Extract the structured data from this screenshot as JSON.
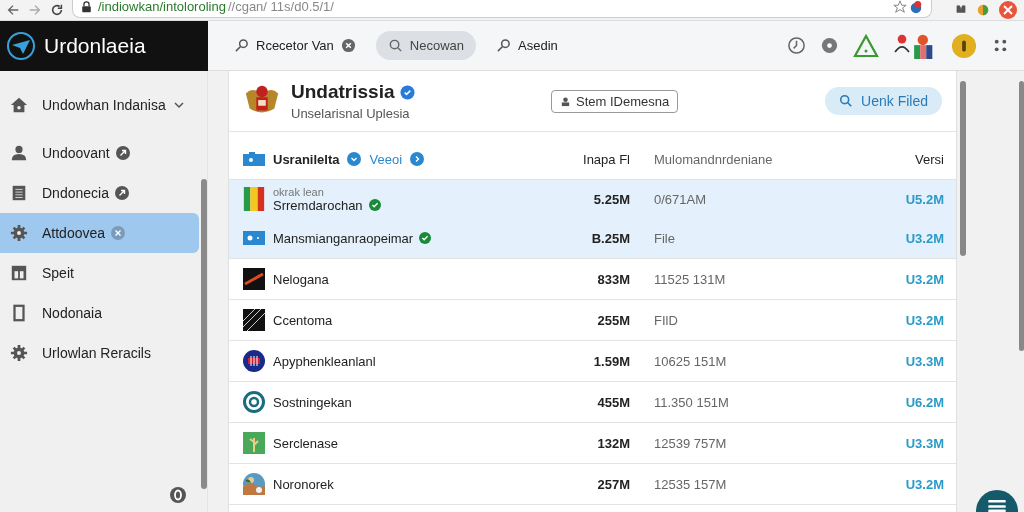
{
  "browser": {
    "url_host": "/indiowkan/intoloroling",
    "url_path": "//cgan/ 11s/d0.5/1/"
  },
  "app": {
    "title": "Urdonlaeia"
  },
  "tabs": [
    {
      "label": "Rcecetor Van",
      "selected": false
    },
    {
      "label": "Necowan",
      "selected": true
    },
    {
      "label": "Asedin",
      "selected": false
    }
  ],
  "sidebar": {
    "items": [
      {
        "label": "Undowhan Indanisa",
        "selected": false
      },
      {
        "label": "Undoovant",
        "selected": false
      },
      {
        "label": "Dndonecia",
        "selected": false
      },
      {
        "label": "Attdoovea",
        "selected": true
      },
      {
        "label": "Speit",
        "selected": false
      },
      {
        "label": "Nodonaia",
        "selected": false
      },
      {
        "label": "Urlowlan Reracils",
        "selected": false
      }
    ]
  },
  "profile": {
    "name": "Undatrissia",
    "verified": true,
    "subtitle": "Unselarisnal Uplesia",
    "tag_button": "Stem IDemesna",
    "search_button": "Uenk Filed"
  },
  "table": {
    "columns": [
      "Usranilelta",
      "Veeoi",
      "Inapa Fl",
      "Mulomandnrdeniane",
      "Versi"
    ],
    "rows": [
      {
        "subtitle": "okrak lean",
        "name": "Srremdarochan",
        "verified": true,
        "size": "5.25M",
        "modified": "0/671AM",
        "version": "U5.2M",
        "selected": true
      },
      {
        "name": "Mansmianganraopeimar",
        "verified": true,
        "size": "B.25M",
        "modified": "File",
        "version": "U3.2M",
        "selected": true
      },
      {
        "name": "Nelogana",
        "verified": false,
        "size": "833M",
        "modified": "11525 131M",
        "version": "U3.2M",
        "selected": false
      },
      {
        "name": "Ccentoma",
        "verified": false,
        "size": "255M",
        "modified": "FIlD",
        "version": "U3.2M",
        "selected": false
      },
      {
        "name": "Apyphenkleanlanl",
        "verified": false,
        "size": "1.59M",
        "modified": "10625 151M",
        "version": "U3.3M",
        "selected": false
      },
      {
        "name": "Sostningekan",
        "verified": false,
        "size": "455M",
        "modified": "11.350 151M",
        "version": "U6.2M",
        "selected": false
      },
      {
        "name": "Serclenase",
        "verified": false,
        "size": "132M",
        "modified": "12539 757M",
        "version": "U3.3M",
        "selected": false
      },
      {
        "name": "Noronorek",
        "verified": false,
        "size": "257M",
        "modified": "12535 157M",
        "version": "U3.2M",
        "selected": false
      }
    ]
  }
}
